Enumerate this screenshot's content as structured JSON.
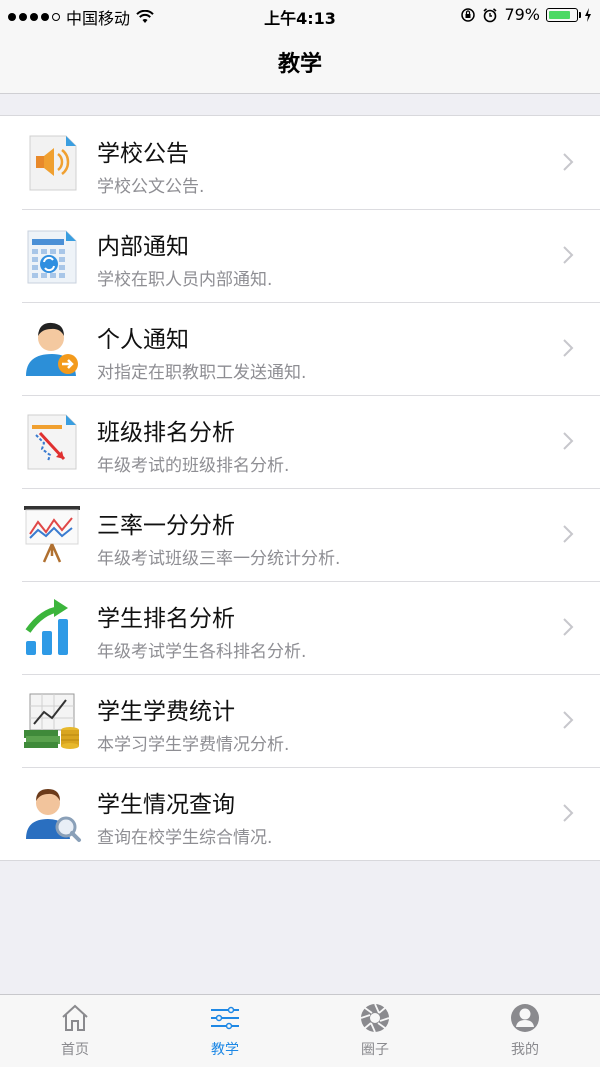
{
  "status_bar": {
    "carrier": "中国移动",
    "time": "上午4:13",
    "battery": "79%",
    "battery_level": 0.79
  },
  "nav": {
    "title": "教学"
  },
  "items": [
    {
      "title": "学校公告",
      "subtitle": "学校公文公告.",
      "icon": "speaker-doc-icon"
    },
    {
      "title": "内部通知",
      "subtitle": "学校在职人员内部通知.",
      "icon": "calendar-refresh-icon"
    },
    {
      "title": "个人通知",
      "subtitle": "对指定在职教职工发送通知.",
      "icon": "user-arrow-icon"
    },
    {
      "title": "班级排名分析",
      "subtitle": "年级考试的班级排名分析.",
      "icon": "chart-doc-icon"
    },
    {
      "title": "三率一分分析",
      "subtitle": "年级考试班级三率一分统计分析.",
      "icon": "easel-chart-icon"
    },
    {
      "title": "学生排名分析",
      "subtitle": "年级考试学生各科排名分析.",
      "icon": "bar-arrow-icon"
    },
    {
      "title": "学生学费统计",
      "subtitle": "本学习学生学费情况分析.",
      "icon": "money-chart-icon"
    },
    {
      "title": "学生情况查询",
      "subtitle": "查询在校学生综合情况.",
      "icon": "user-search-icon"
    }
  ],
  "tabs": [
    {
      "label": "首页",
      "icon": "home-icon",
      "active": false
    },
    {
      "label": "教学",
      "icon": "sliders-icon",
      "active": true
    },
    {
      "label": "圈子",
      "icon": "aperture-icon",
      "active": false
    },
    {
      "label": "我的",
      "icon": "person-icon",
      "active": false
    }
  ],
  "colors": {
    "accent": "#1e88e5",
    "battery": "#4cd964",
    "background": "#efeff4"
  }
}
